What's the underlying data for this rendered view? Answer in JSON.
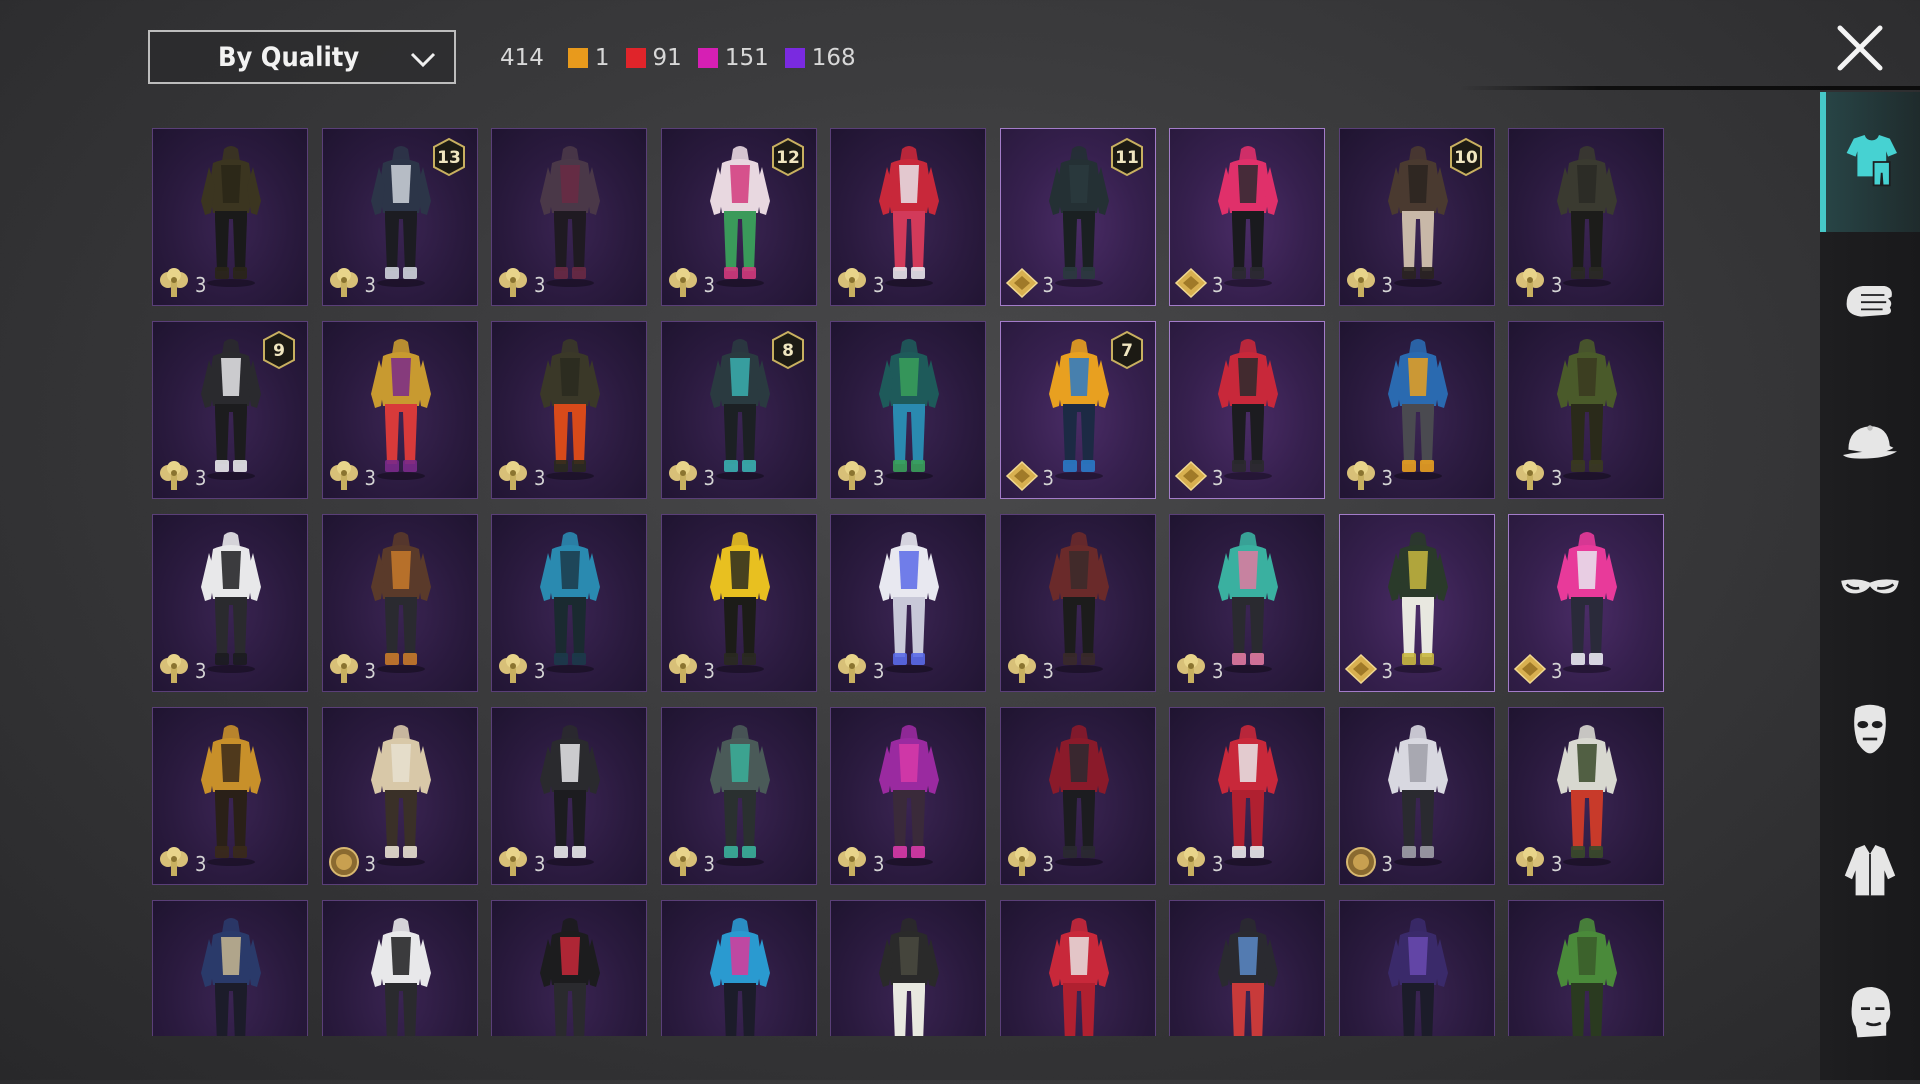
{
  "toolbar": {
    "sort_label": "By Quality",
    "total": "414",
    "quality_counts": [
      {
        "color": "#e89a1c",
        "count": "1"
      },
      {
        "color": "#e0242a",
        "count": "91"
      },
      {
        "color": "#d61fb4",
        "count": "151"
      },
      {
        "color": "#7a2ae0",
        "count": "168"
      }
    ]
  },
  "sidebar": {
    "categories": [
      {
        "icon": "outfit-icon",
        "active": true
      },
      {
        "icon": "glove-icon",
        "active": false
      },
      {
        "icon": "cap-icon",
        "active": false
      },
      {
        "icon": "goggles-icon",
        "active": false
      },
      {
        "icon": "mask-icon",
        "active": false
      },
      {
        "icon": "jacket-icon",
        "active": false
      },
      {
        "icon": "head-icon",
        "active": false
      }
    ]
  },
  "items": [
    {
      "colors": [
        "#3b3520",
        "#2a2618",
        "#1a1a1a"
      ],
      "level": "",
      "emblem": "clover",
      "count": "3"
    },
    {
      "colors": [
        "#2c3548",
        "#cfd3dc",
        "#1c1c22"
      ],
      "level": "13",
      "emblem": "clover",
      "count": "3"
    },
    {
      "colors": [
        "#4a3848",
        "#6a2a44",
        "#1f1a22"
      ],
      "level": "",
      "emblem": "clover",
      "count": "3"
    },
    {
      "colors": [
        "#e8d8e0",
        "#d23a7c",
        "#3a9a5a"
      ],
      "level": "12",
      "emblem": "clover",
      "count": "3"
    },
    {
      "colors": [
        "#c8283a",
        "#e8e4ea",
        "#d23a5a"
      ],
      "level": "",
      "emblem": "clover",
      "count": "3"
    },
    {
      "colors": [
        "#243034",
        "#2a3a3e",
        "#1a2022"
      ],
      "level": "11",
      "emblem": "diamond",
      "count": "3"
    },
    {
      "colors": [
        "#e0306a",
        "#2a2a30",
        "#1a1a1e"
      ],
      "level": "",
      "emblem": "diamond",
      "count": "3"
    },
    {
      "colors": [
        "#4a3a30",
        "#2a2420",
        "#c8b8a8"
      ],
      "level": "10",
      "emblem": "clover",
      "count": "3"
    },
    {
      "colors": [
        "#3a3a30",
        "#2a2a24",
        "#1c1c1a"
      ],
      "level": "",
      "emblem": "clover",
      "count": "3"
    },
    {
      "colors": [
        "#2a2a2e",
        "#e8e8ea",
        "#1c1c1e"
      ],
      "level": "9",
      "emblem": "clover",
      "count": "3"
    },
    {
      "colors": [
        "#c89a30",
        "#7a2a8a",
        "#d83a3a"
      ],
      "level": "",
      "emblem": "clover",
      "count": "3"
    },
    {
      "colors": [
        "#3a3828",
        "#2a2a1e",
        "#d84a1a"
      ],
      "level": "",
      "emblem": "clover",
      "count": "3"
    },
    {
      "colors": [
        "#2a3a40",
        "#3ab0b0",
        "#1c2024"
      ],
      "level": "8",
      "emblem": "clover",
      "count": "3"
    },
    {
      "colors": [
        "#1e5a5a",
        "#3aa05a",
        "#2a8ab0"
      ],
      "level": "",
      "emblem": "clover",
      "count": "3"
    },
    {
      "colors": [
        "#e8a020",
        "#2a7ac8",
        "#1c2a44"
      ],
      "level": "7",
      "emblem": "diamond",
      "count": "3"
    },
    {
      "colors": [
        "#c8283a",
        "#2a2a2e",
        "#1c1c20"
      ],
      "level": "",
      "emblem": "diamond",
      "count": "3"
    },
    {
      "colors": [
        "#2a6ab0",
        "#e8a020",
        "#4a4a50"
      ],
      "level": "",
      "emblem": "clover",
      "count": "3"
    },
    {
      "colors": [
        "#4a5a2a",
        "#3a3a20",
        "#2a2a1a"
      ],
      "level": "",
      "emblem": "clover",
      "count": "3"
    },
    {
      "colors": [
        "#e8e8ea",
        "#1c1c20",
        "#2a2a2e"
      ],
      "level": "",
      "emblem": "clover",
      "count": "3"
    },
    {
      "colors": [
        "#5a3a2a",
        "#c87a2a",
        "#2a2a30"
      ],
      "level": "",
      "emblem": "clover",
      "count": "3"
    },
    {
      "colors": [
        "#2a8ab0",
        "#1c3a4a",
        "#1a2a30"
      ],
      "level": "",
      "emblem": "clover",
      "count": "3"
    },
    {
      "colors": [
        "#e8c020",
        "#2a2a20",
        "#1c1c18"
      ],
      "level": "",
      "emblem": "clover",
      "count": "3"
    },
    {
      "colors": [
        "#e8e8f0",
        "#5a6ae8",
        "#c8c8d8"
      ],
      "level": "",
      "emblem": "clover",
      "count": "3"
    },
    {
      "colors": [
        "#6a2a2a",
        "#3a2a2a",
        "#1c1c1c"
      ],
      "level": "",
      "emblem": "clover",
      "count": "3"
    },
    {
      "colors": [
        "#3ab0a0",
        "#e07aa0",
        "#2a2a30"
      ],
      "level": "",
      "emblem": "clover",
      "count": "3"
    },
    {
      "colors": [
        "#2a3a2a",
        "#c8b840",
        "#e8e8e0"
      ],
      "level": "",
      "emblem": "diamond",
      "count": "3"
    },
    {
      "colors": [
        "#e83a9a",
        "#e8e8f0",
        "#2a2a3a"
      ],
      "level": "",
      "emblem": "diamond",
      "count": "3"
    },
    {
      "colors": [
        "#c8902a",
        "#3a2a1a",
        "#2a2018"
      ],
      "level": "",
      "emblem": "clover",
      "count": "3"
    },
    {
      "colors": [
        "#d8c8a8",
        "#e8e0d0",
        "#3a3028"
      ],
      "level": "",
      "emblem": "medal",
      "count": "3"
    },
    {
      "colors": [
        "#2a2a2e",
        "#e8e8ea",
        "#1c1c20"
      ],
      "level": "",
      "emblem": "clover",
      "count": "3"
    },
    {
      "colors": [
        "#4a5a58",
        "#3ab09a",
        "#2a3030"
      ],
      "level": "",
      "emblem": "clover",
      "count": "3"
    },
    {
      "colors": [
        "#9a2aa0",
        "#d83aa8",
        "#3a2a3a"
      ],
      "level": "",
      "emblem": "clover",
      "count": "3"
    },
    {
      "colors": [
        "#8a1a2a",
        "#2a2a30",
        "#1c1c20"
      ],
      "level": "",
      "emblem": "clover",
      "count": "3"
    },
    {
      "colors": [
        "#c8283a",
        "#e8e8ea",
        "#b02030"
      ],
      "level": "",
      "emblem": "clover",
      "count": "3"
    },
    {
      "colors": [
        "#d8d8e0",
        "#a0a0a8",
        "#2a2a30"
      ],
      "level": "",
      "emblem": "medal",
      "count": "3"
    },
    {
      "colors": [
        "#d8d8d0",
        "#3a4a2a",
        "#c83a2a"
      ],
      "level": "",
      "emblem": "clover",
      "count": "3"
    },
    {
      "colors": [
        "#2a3a6a",
        "#c8b890",
        "#1c1c2a"
      ],
      "level": "",
      "emblem": "",
      "count": ""
    },
    {
      "colors": [
        "#e8e8ea",
        "#1c1c1e",
        "#2a2a2e"
      ],
      "level": "",
      "emblem": "",
      "count": ""
    },
    {
      "colors": [
        "#1c1c1e",
        "#c8283a",
        "#2a2a2e"
      ],
      "level": "",
      "emblem": "",
      "count": ""
    },
    {
      "colors": [
        "#2a9ad0",
        "#d83a9a",
        "#1c1c2a"
      ],
      "level": "",
      "emblem": "",
      "count": ""
    },
    {
      "colors": [
        "#2a2a2a",
        "#4a4a40",
        "#e8e8e0"
      ],
      "level": "",
      "emblem": "",
      "count": ""
    },
    {
      "colors": [
        "#c8283a",
        "#e8e0e0",
        "#b02030"
      ],
      "level": "",
      "emblem": "",
      "count": ""
    },
    {
      "colors": [
        "#2a2a30",
        "#5a8ac8",
        "#c83a3a"
      ],
      "level": "",
      "emblem": "",
      "count": ""
    },
    {
      "colors": [
        "#3a2a6a",
        "#6a4ab0",
        "#1c1c2a"
      ],
      "level": "",
      "emblem": "",
      "count": ""
    },
    {
      "colors": [
        "#4a8a3a",
        "#3a5a2a",
        "#2a3a20"
      ],
      "level": "",
      "emblem": "",
      "count": ""
    }
  ],
  "highlighted": [
    5,
    6,
    14,
    15,
    25,
    26
  ]
}
